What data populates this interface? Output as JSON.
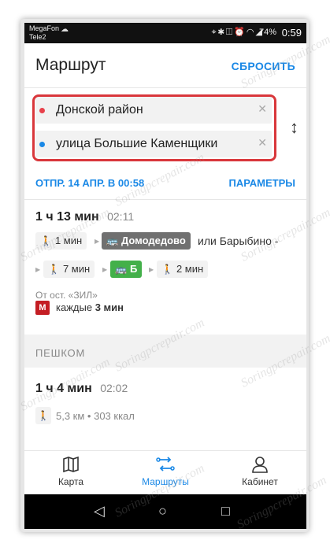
{
  "status": {
    "carrier1": "MegaFon",
    "carrier2": "Tele2",
    "battery": "74%",
    "time": "0:59"
  },
  "header": {
    "title": "Маршрут",
    "reset": "СБРОСИТЬ"
  },
  "fields": {
    "from": "Донской район",
    "to": "улица Большие Каменщики",
    "colors": {
      "from_dot": "#e8414b",
      "to_dot": "#1a88e6"
    }
  },
  "departure": {
    "label": "ОТПР. 14 АПР. В 00:58",
    "params": "ПАРАМЕТРЫ"
  },
  "transit_route": {
    "duration": "1 ч 13 мин",
    "arrival": "02:11",
    "walk1": "1 мин",
    "bus_stop": "Домодедово",
    "alt": "или Барыбино -",
    "walk2": "7 мин",
    "bus_letter": "Б",
    "walk3": "2 мин",
    "from_stop": "От ост. «ЗИЛ»",
    "metro_icon": "М",
    "frequency_prefix": "каждые",
    "frequency_value": "3 мин"
  },
  "walking": {
    "section_label": "ПЕШКОМ",
    "duration": "1 ч 4 мин",
    "arrival": "02:02",
    "info": "5,3 км • 303 ккал"
  },
  "nav": {
    "map": "Карта",
    "routes": "Маршруты",
    "cabinet": "Кабинет"
  },
  "watermark": "Soringpcrepair.com"
}
